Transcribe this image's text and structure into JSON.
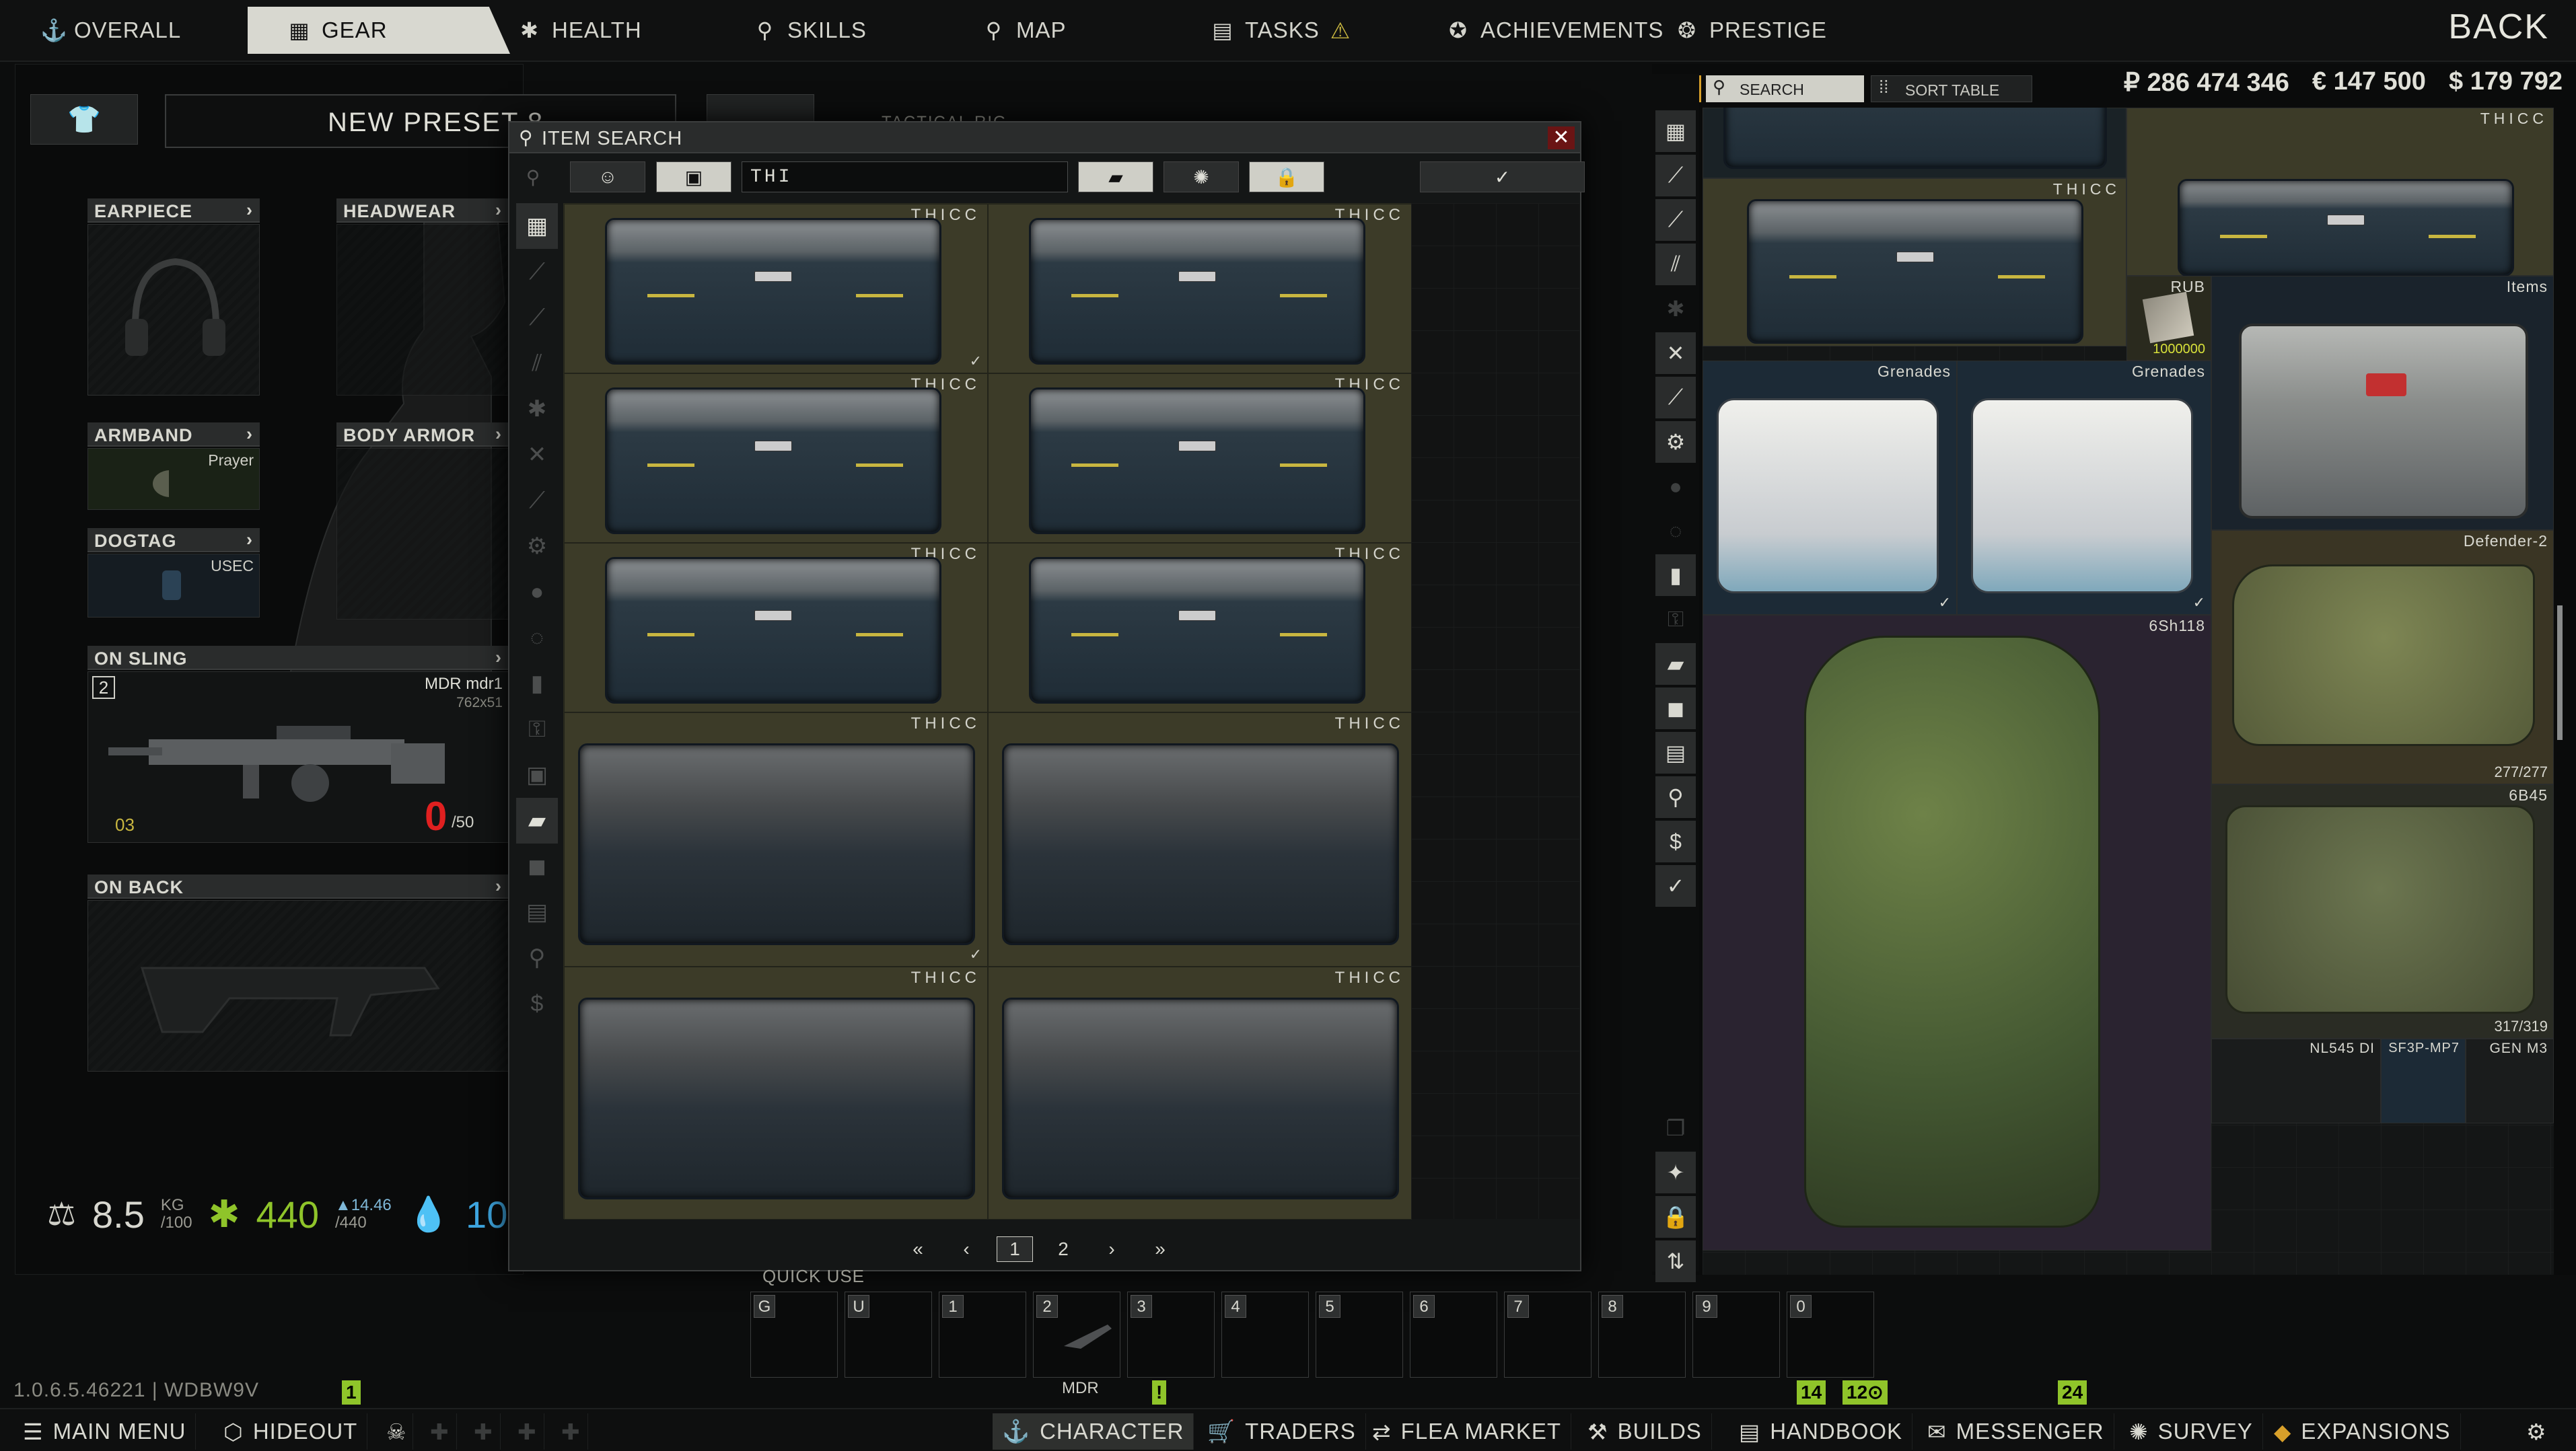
{
  "topnav": {
    "tabs": [
      {
        "label": "OVERALL",
        "icon": "anchor-icon",
        "glyph": "⚓"
      },
      {
        "label": "GEAR",
        "icon": "gear-grid-icon",
        "glyph": "▦"
      },
      {
        "label": "HEALTH",
        "icon": "health-icon",
        "glyph": "✱"
      },
      {
        "label": "SKILLS",
        "icon": "skills-icon",
        "glyph": "⚲"
      },
      {
        "label": "MAP",
        "icon": "map-pin-icon",
        "glyph": "⚲"
      },
      {
        "label": "TASKS",
        "icon": "tasks-icon",
        "glyph": "▤"
      },
      {
        "label": "ACHIEVEMENTS",
        "icon": "achievements-icon",
        "glyph": "✪"
      },
      {
        "label": "PRESTIGE",
        "icon": "prestige-icon",
        "glyph": "❂"
      }
    ],
    "back_label": "BACK",
    "tasks_alert": "⚠"
  },
  "gear": {
    "preset_icon": "👕",
    "preset_name": "NEW PRESET 8",
    "slots": {
      "earpiece": "EARPIECE",
      "headwear": "HEADWEAR",
      "armband": "ARMBAND",
      "armband_item": "Prayer",
      "body_armor": "BODY ARMOR",
      "dogtag": "DOGTAG",
      "dogtag_item": "USEC",
      "on_sling": "ON SLING",
      "sling_item": "MDR mdr1",
      "sling_caliber": "762x51",
      "sling_slot": "2",
      "sling_ammo": "0",
      "sling_ammo_max": "/50",
      "sling_mods": "03",
      "on_back": "ON BACK"
    },
    "stats": {
      "weight": "8.5",
      "weight_unit": "KG",
      "weight_max": "/100",
      "energy": "440",
      "energy_max": "/440",
      "energy_rate": "▲14.46",
      "hydration": "10"
    },
    "tactical_rig": "TACTICAL RIG"
  },
  "search": {
    "title": "ITEM SEARCH",
    "close": "✕",
    "query": "THI",
    "items": [
      "THICC",
      "THICC",
      "THICC",
      "THICC",
      "THICC",
      "THICC",
      "THICC",
      "THICC",
      "THICC",
      "THICC",
      "THICC",
      "THICC"
    ],
    "pages": {
      "first": "«",
      "prev": "‹",
      "p1": "1",
      "p2": "2",
      "next": "›",
      "last": "»"
    }
  },
  "stash": {
    "search_label": "SEARCH",
    "sort_label": "SORT TABLE",
    "currency": {
      "rub": "₽ 286 474 346",
      "eur": "€ 147 500",
      "usd": "$ 179 792"
    },
    "items": {
      "thicc_a": "THICC",
      "thicc_b": "THICC",
      "rub": "RUB",
      "rub_count": "1000000",
      "items_case": "Items",
      "grenades_a": "Grenades",
      "grenades_b": "Grenades",
      "backpack": "6Sh118",
      "armor": "Defender-2",
      "armor_dur": "277/277",
      "rig": "6B45",
      "rig_dur": "317/319",
      "nl": "NL545 DI",
      "sf": "SF3P-MP7",
      "gen": "GEN M3"
    }
  },
  "quickuse": {
    "title": "QUICK USE",
    "keys": [
      "G",
      "U",
      "1",
      "2",
      "3",
      "4",
      "5",
      "6",
      "7",
      "8",
      "9",
      "0"
    ],
    "slot2_item": "MDR"
  },
  "bottom": {
    "version": "1.0.6.5.46221 | WDBW9V",
    "badge_main": "1",
    "badge_char": "!",
    "badge_hb1": "14",
    "badge_hb2": "12⊙",
    "badge_msg": "24",
    "buttons": {
      "main_menu": "MAIN MENU",
      "hideout": "HIDEOUT",
      "character": "CHARACTER",
      "traders": "TRADERS",
      "flea": "FLEA MARKET",
      "builds": "BUILDS",
      "handbook": "HANDBOOK",
      "messenger": "MESSENGER",
      "survey": "SURVEY",
      "expansions": "EXPANSIONS"
    }
  },
  "colors": {
    "accent": "#8fc42a",
    "case_stripe": "#c8b640",
    "grid_highlight": "#3c3b28",
    "close": "#6a1414"
  }
}
